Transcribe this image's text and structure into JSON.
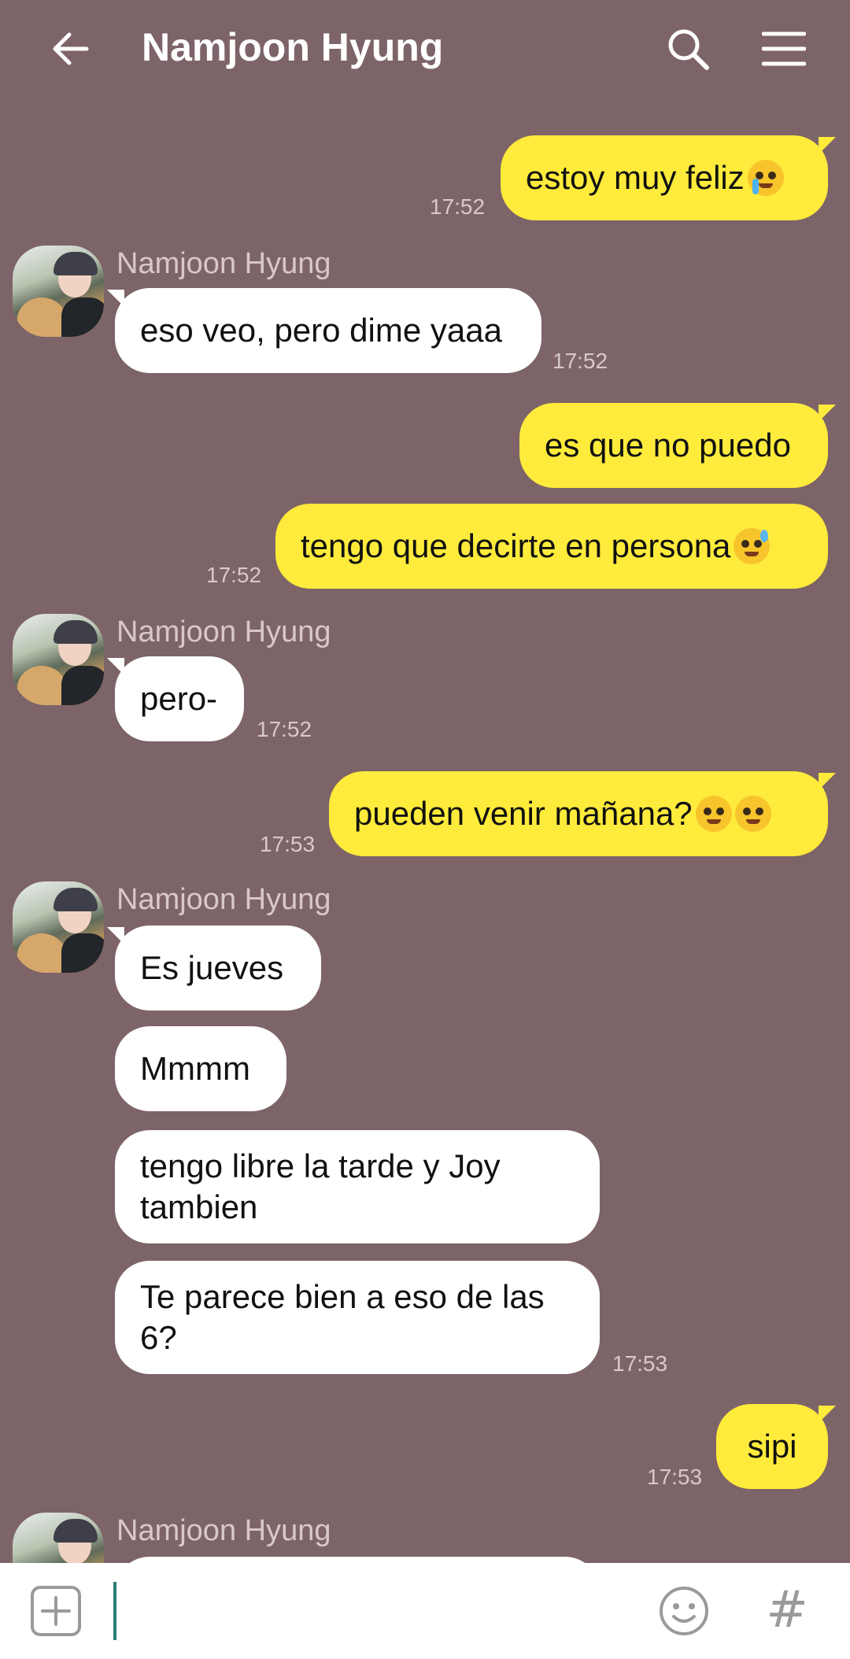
{
  "header": {
    "title": "Namjoon Hyung",
    "back_icon": "arrow-left-icon",
    "search_icon": "search-icon",
    "menu_icon": "hamburger-menu-icon"
  },
  "messages": {
    "m1": {
      "text": "estoy muy feliz",
      "emoji": "loudly-crying-face-emoji",
      "time": "17:52"
    },
    "m2": {
      "sender": "Namjoon Hyung",
      "text": "eso veo, pero dime yaaa",
      "time": "17:52"
    },
    "m3": {
      "text": "es que no puedo"
    },
    "m4": {
      "text": "tengo que decirte en persona",
      "emoji": "grinning-sweat-emoji",
      "time": "17:52"
    },
    "m5": {
      "sender": "Namjoon Hyung",
      "text": "pero-",
      "time": "17:52"
    },
    "m6": {
      "text": "pueden venir mañana? ",
      "emoji": "pleading-face-emoji",
      "time": "17:53"
    },
    "m7": {
      "sender": "Namjoon Hyung",
      "text": "Es jueves"
    },
    "m8": {
      "text": "Mmmm"
    },
    "m9": {
      "text": "tengo libre la tarde y Joy tambien"
    },
    "m10": {
      "text": "Te parece bien a eso de las 6?",
      "time": "17:53"
    },
    "m11": {
      "text": "sipi",
      "time": "17:53"
    },
    "m12": {
      "sender": "Namjoon Hyung"
    }
  },
  "composer": {
    "plus_icon": "plus-square-icon",
    "emoji_icon": "smiley-icon",
    "hash_label": "#"
  },
  "colors": {
    "background": "#7d6468",
    "my_bubble": "#ffeb3b",
    "their_bubble": "#ffffff",
    "cursor": "#2a7d72"
  }
}
